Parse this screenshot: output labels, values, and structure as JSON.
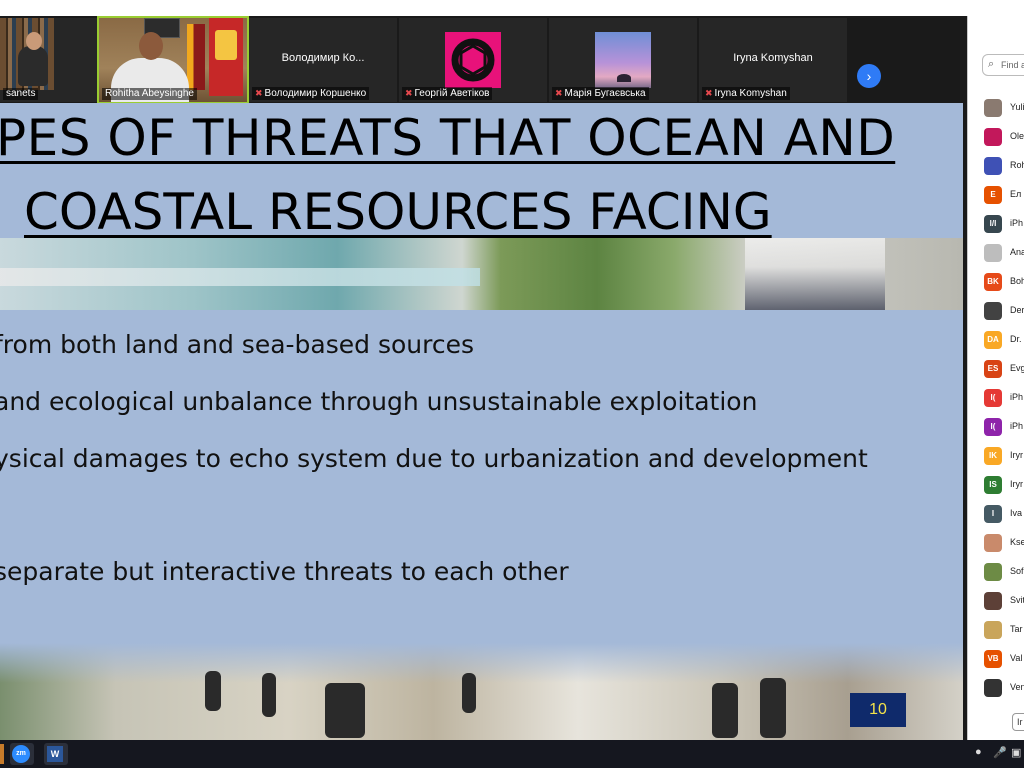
{
  "participants_strip": [
    {
      "name": "sanets"
    },
    {
      "name": "Rohitha Abeysinghe"
    },
    {
      "name": "Володимир Коршенко",
      "center": "Володимир Ко..."
    },
    {
      "name": "Георгій Аветіков"
    },
    {
      "name": "Марія Бугаєвська"
    },
    {
      "name": "Iryna Komyshan",
      "center": "Iryna Komyshan"
    }
  ],
  "strip_next_icon": "chevron-right-icon",
  "slide": {
    "title_line1": "PES OF THREATS THAT OCEAN AND",
    "title_line2": "COASTAL RESOURCES FACING",
    "bullets": [
      "from both land and sea-based sources",
      "and ecological unbalance through unsustainable exploitation",
      "ysical damages to echo system due to urbanization and development",
      "separate but interactive threats to each other"
    ],
    "page_number": "10"
  },
  "panel": {
    "search_placeholder": "Find a",
    "participants": [
      {
        "label": "Yuli",
        "avatar": "",
        "color": "#8a7a70"
      },
      {
        "label": "Ole",
        "avatar": "",
        "color": "#c2185b"
      },
      {
        "label": "Roh",
        "avatar": "",
        "color": "#3f51b5"
      },
      {
        "label": "Ел",
        "avatar": "E",
        "color": "#e65100"
      },
      {
        "label": "iPh",
        "avatar": "I/I",
        "color": "#37474f"
      },
      {
        "label": "Ana",
        "avatar": "",
        "color": "#bdbdbd"
      },
      {
        "label": "Boh",
        "avatar": "BK",
        "color": "#e64a19"
      },
      {
        "label": "Der",
        "avatar": "",
        "color": "#424242"
      },
      {
        "label": "Dr.",
        "avatar": "DA",
        "color": "#f9a825"
      },
      {
        "label": "Evg",
        "avatar": "ES",
        "color": "#d84315"
      },
      {
        "label": "iPh",
        "avatar": "I(",
        "color": "#e53935"
      },
      {
        "label": "iPh",
        "avatar": "I(",
        "color": "#8e24aa"
      },
      {
        "label": "Iryr",
        "avatar": "IK",
        "color": "#f9a825"
      },
      {
        "label": "Iryr",
        "avatar": "IS",
        "color": "#2e7d32"
      },
      {
        "label": "Iva",
        "avatar": "I",
        "color": "#455a64"
      },
      {
        "label": "Kse",
        "avatar": "",
        "color": "#c98a6b"
      },
      {
        "label": "Sof",
        "avatar": "",
        "color": "#6d8b45"
      },
      {
        "label": "Svit",
        "avatar": "",
        "color": "#5d4037"
      },
      {
        "label": "Tar",
        "avatar": "",
        "color": "#c9a55b"
      },
      {
        "label": "Val",
        "avatar": "VB",
        "color": "#e65100"
      },
      {
        "label": "Ven",
        "avatar": "",
        "color": "#333333"
      }
    ],
    "footer_button": "Ir"
  },
  "taskbar": {
    "apps": [
      {
        "name": "zoom",
        "label": "zm"
      },
      {
        "name": "word",
        "label": "W"
      }
    ]
  },
  "colors": {
    "slide_bg": "#a4b9d8",
    "page_badge": "#0f2a6b",
    "page_text": "#f4e34a",
    "zoom_blue": "#2f7bf6"
  }
}
